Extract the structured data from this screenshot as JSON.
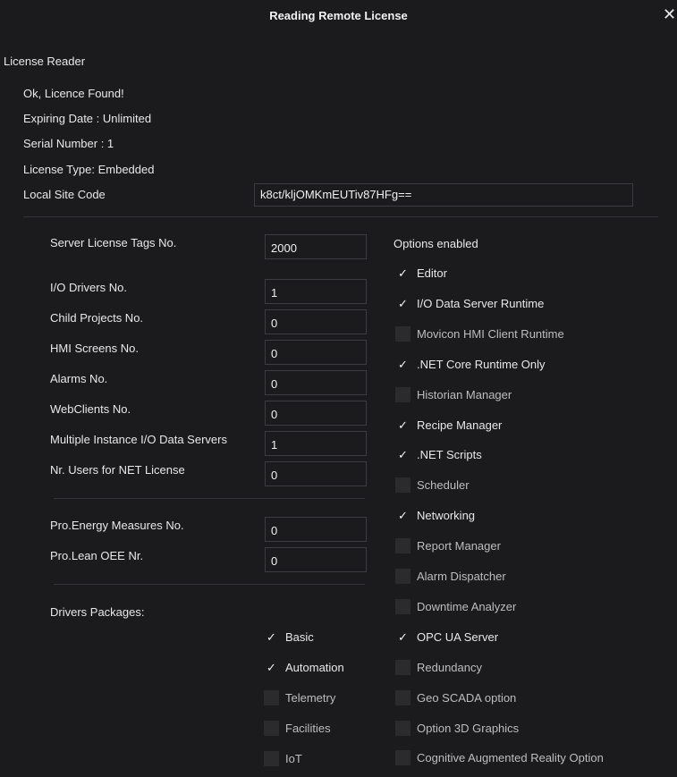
{
  "window": {
    "title": "Reading Remote License",
    "close_glyph": "✕"
  },
  "section_header": "License Reader",
  "info": {
    "status": "Ok, Licence Found!",
    "expiring": "Expiring Date : Unlimited",
    "serial": "Serial Number : 1",
    "type": "License Type:  Embedded",
    "site_code_label": "Local Site Code",
    "site_code_value": "k8ct/kljOMKmEUTiv87HFg=="
  },
  "counts": [
    {
      "label": "Server License Tags No.",
      "value": "2000"
    },
    {
      "label": "I/O Drivers No.",
      "value": "1"
    },
    {
      "label": "Child Projects No.",
      "value": "0"
    },
    {
      "label": "HMI Screens No.",
      "value": "0"
    },
    {
      "label": "Alarms No.",
      "value": "0"
    },
    {
      "label": "WebClients No.",
      "value": "0"
    },
    {
      "label": "Multiple Instance I/O Data Servers",
      "value": "1"
    },
    {
      "label": "Nr. Users for NET License",
      "value": "0"
    }
  ],
  "pro": [
    {
      "label": "Pro.Energy Measures No.",
      "value": "0"
    },
    {
      "label": "Pro.Lean OEE Nr.",
      "value": "0"
    }
  ],
  "drivers": {
    "label": "Drivers Packages:",
    "items": [
      {
        "label": "Basic",
        "checked": true
      },
      {
        "label": "Automation",
        "checked": true
      },
      {
        "label": "Telemetry",
        "checked": false
      },
      {
        "label": "Facilities",
        "checked": false
      },
      {
        "label": "IoT",
        "checked": false
      }
    ]
  },
  "options": {
    "header": "Options enabled",
    "items": [
      {
        "label": "Editor",
        "checked": true
      },
      {
        "label": "I/O Data Server Runtime",
        "checked": true
      },
      {
        "label": "Movicon HMI Client Runtime",
        "checked": false
      },
      {
        "label": ".NET Core Runtime Only",
        "checked": true
      },
      {
        "label": "Historian Manager",
        "checked": false
      },
      {
        "label": "Recipe Manager",
        "checked": true
      },
      {
        "label": ".NET Scripts",
        "checked": true
      },
      {
        "label": "Scheduler",
        "checked": false
      },
      {
        "label": "Networking",
        "checked": true
      },
      {
        "label": "Report Manager",
        "checked": false
      },
      {
        "label": "Alarm Dispatcher",
        "checked": false
      },
      {
        "label": "Downtime Analyzer",
        "checked": false
      },
      {
        "label": "OPC UA Server",
        "checked": true
      },
      {
        "label": "Redundancy",
        "checked": false
      },
      {
        "label": "Geo SCADA option",
        "checked": false
      },
      {
        "label": "Option 3D Graphics",
        "checked": false
      },
      {
        "label": "Cognitive Augmented Reality Option",
        "checked": false
      }
    ]
  },
  "check_glyph": "✓"
}
